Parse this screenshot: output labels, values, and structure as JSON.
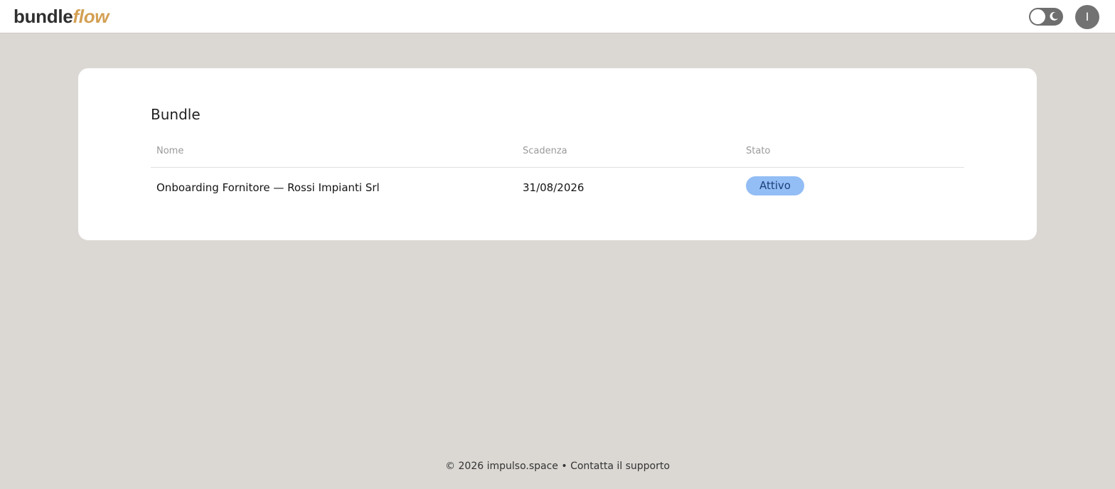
{
  "header": {
    "logo_part1": "bundle",
    "logo_part2": "flow",
    "avatar_initial": "I",
    "theme_toggle_icon": "moon-icon"
  },
  "main": {
    "title": "Bundle",
    "columns": [
      "Nome",
      "Scadenza",
      "Stato"
    ],
    "rows": [
      {
        "nome": "Onboarding Fornitore — Rossi Impianti Srl",
        "scadenza": "31/08/2026",
        "stato": "Attivo"
      }
    ]
  },
  "footer": {
    "copyright": "© 2026 impulso.space",
    "separator": " • ",
    "support_link": "Contatta il supporto"
  },
  "colors": {
    "background": "#dbd8d4",
    "brand_accent": "#d3a054",
    "badge_active_bg": "#93bdf5",
    "badge_active_text": "#1d3f78"
  }
}
